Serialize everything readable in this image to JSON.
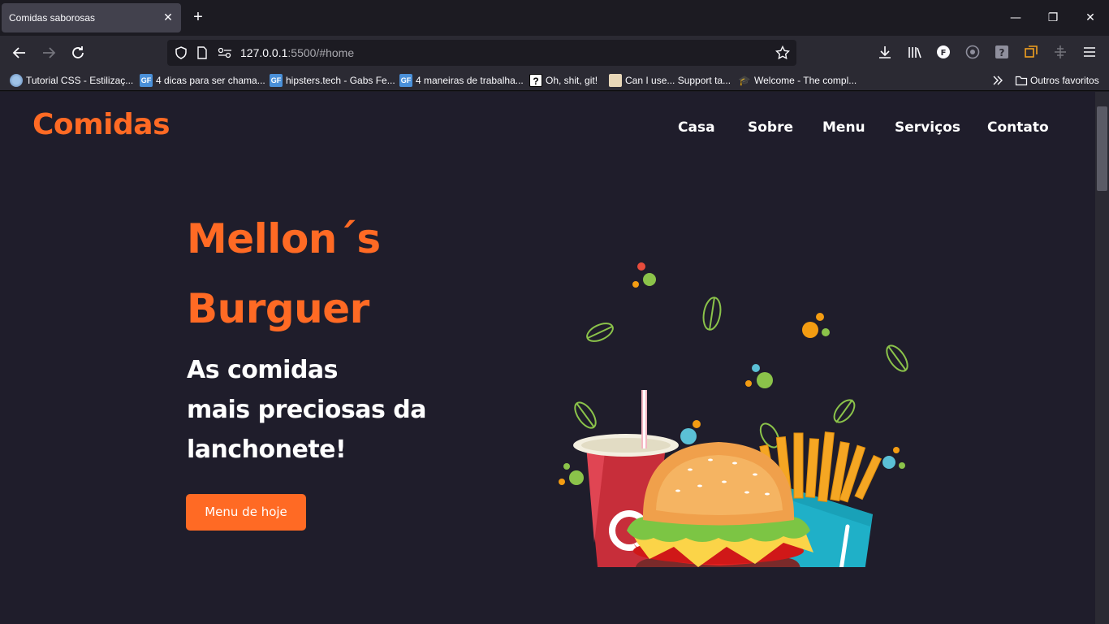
{
  "browser": {
    "tab": {
      "title": "Comidas saborosas",
      "close": "✕"
    },
    "new_tab": "+",
    "window_controls": {
      "minimize": "—",
      "restore": "❐",
      "close": "✕"
    },
    "url": {
      "host": "127.0.0.1",
      "rest": ":5500/#home"
    },
    "bookmarks": [
      {
        "label": "Tutorial CSS - Estilizaç...",
        "icon": "globe-icon"
      },
      {
        "label": "4 dicas para ser chama...",
        "icon": "gf-icon"
      },
      {
        "label": "hipsters.tech - Gabs Fe...",
        "icon": "gf-icon"
      },
      {
        "label": "4 maneiras de trabalha...",
        "icon": "gf-icon"
      },
      {
        "label": "Oh, shit, git!",
        "icon": "question-icon"
      },
      {
        "label": "Can I use... Support ta...",
        "icon": "caniuse-icon"
      },
      {
        "label": "Welcome - The compl...",
        "icon": "graduation-cap-icon"
      }
    ],
    "other_bookmarks": "Outros favoritos"
  },
  "site": {
    "logo": "Comidas",
    "nav": [
      "Casa",
      "Sobre",
      "Menu",
      "Serviços",
      "Contato"
    ],
    "hero": {
      "title_line1": "Mellon´s",
      "title_line2": "Burguer",
      "subtitle_line1": "As comidas",
      "subtitle_line2": "mais preciosas da",
      "subtitle_line3": "lanchonete!",
      "button": "Menu de hoje"
    }
  },
  "colors": {
    "accent": "#ff6a24",
    "page_bg": "#1f1d2b",
    "chrome_bg": "#2b2a33"
  }
}
